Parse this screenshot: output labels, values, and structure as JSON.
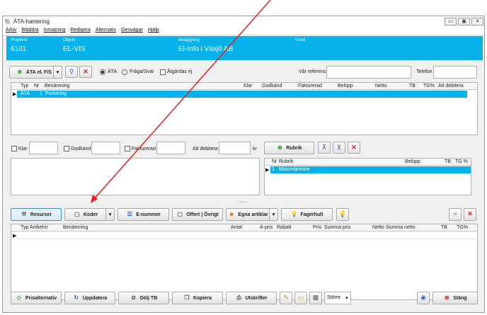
{
  "window": {
    "title": "ÄTA-hantering"
  },
  "menu": [
    "Arkiv",
    "Bläddra",
    "Inmatning",
    "Redigera",
    "Alternativ",
    "Genvägar",
    "Hjälp"
  ],
  "header": {
    "projektnr_label": "Projektnr",
    "projektnr": "6101",
    "objekt_label": "Objekt",
    "objekt": "EL-VIS",
    "anlaggning_label": "Anläggning",
    "anlaggning": "El-Info i Växjö AB",
    "kund_label": "Kund"
  },
  "toolbar": {
    "ata_type": "ÄTA el. F/S",
    "radio_ata": "ÄTA",
    "radio_fraga": "Fråga/Svar",
    "atgardas": "Åtgärdas ej",
    "var_referens": "Vår referens",
    "telefon": "Telefon"
  },
  "ata_grid": {
    "columns": [
      "Typ",
      "Nr",
      "Benämning",
      "Klar",
      "Godkänd",
      "Fakturerad",
      "Belopp",
      "Netto",
      "TB",
      "TG%",
      "Att debitera"
    ],
    "rows": [
      {
        "typ": "ÄTA",
        "nr": "1",
        "benamning": "Parkering"
      }
    ]
  },
  "status_row": {
    "klar": "Klar",
    "godkand": "Godkänd",
    "fakturerad": "Fakturerad",
    "att_debitera": "Att debitera",
    "kr": "kr",
    "rubrik_btn": "Rubrik"
  },
  "rubrik_grid": {
    "columns": [
      "Nr",
      "Rubrik",
      "Belopp",
      "TB",
      "TG %"
    ],
    "rows": [
      {
        "nr": "1",
        "rubrik": "Motorvärmare"
      }
    ]
  },
  "tabs": [
    "Resurser",
    "Koder",
    "E-nummer",
    "Offert | Övrigt",
    "Egna artiklar",
    "Fagerhult"
  ],
  "articles_grid": {
    "columns": [
      "Typ",
      "Artikelnr",
      "Benämning",
      "Antal",
      "Á-pris",
      "Rabatt",
      "Pris",
      "Summa pris",
      "Netto",
      "Summa netto",
      "TB",
      "TG%"
    ]
  },
  "bottom": {
    "prisalternativ": "Prisalternativ",
    "uppdatera": "Uppdatera",
    "dolj_tb": "Dölj TB",
    "kopiera": "Kopiera",
    "utskrifter": "Utskrifter",
    "size_select": "Större",
    "stang": "Stäng"
  },
  "colors": {
    "accent": "#06b2e9",
    "arrow": "#e8201e"
  }
}
